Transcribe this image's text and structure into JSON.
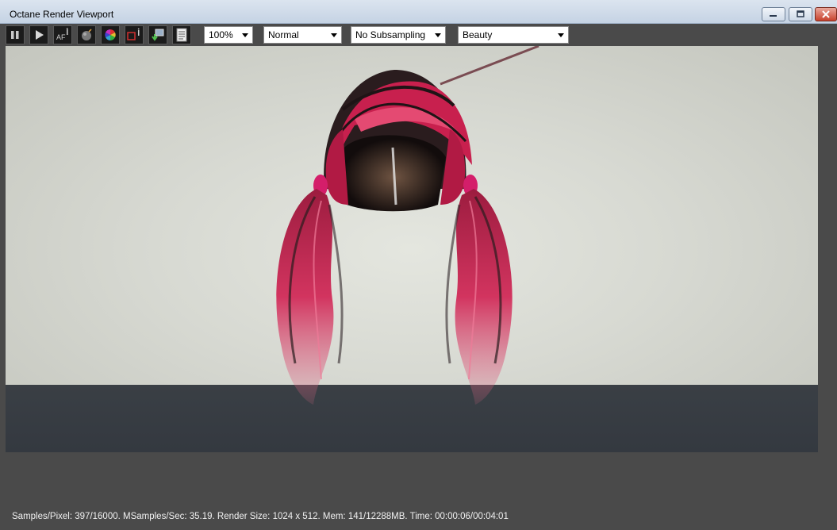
{
  "window": {
    "title": "Octane Render Viewport",
    "controls": {
      "minimize": "minimize-icon",
      "maximize": "maximize-icon",
      "close": "close-icon"
    }
  },
  "toolbar": {
    "buttons": [
      {
        "name": "pause-button",
        "icon": "pause-icon"
      },
      {
        "name": "play-button",
        "icon": "play-icon"
      },
      {
        "name": "auto-focus-button",
        "icon": "af-icon"
      },
      {
        "name": "bomb-button",
        "icon": "bomb-icon"
      },
      {
        "name": "color-picker-button",
        "icon": "color-wheel-icon"
      },
      {
        "name": "region-render-button",
        "icon": "region-icon"
      },
      {
        "name": "save-image-button",
        "icon": "save-down-icon"
      },
      {
        "name": "info-panel-button",
        "icon": "document-icon"
      }
    ],
    "zoom": {
      "value": "100%"
    },
    "mode": {
      "value": "Normal"
    },
    "subsampling": {
      "value": "No Subsampling"
    },
    "pass": {
      "value": "Beauty"
    }
  },
  "viewport": {
    "colors": {
      "background": "#d7d9d2",
      "floor": "#373c42",
      "hair_primary": "#c8204e",
      "hair_dark": "#2a1c1e"
    }
  },
  "status": {
    "text": "Samples/Pixel: 397/16000. MSamples/Sec: 35.19. Render Size: 1024 x 512. Mem: 141/12288MB. Time: 00:00:06/00:04:01"
  }
}
